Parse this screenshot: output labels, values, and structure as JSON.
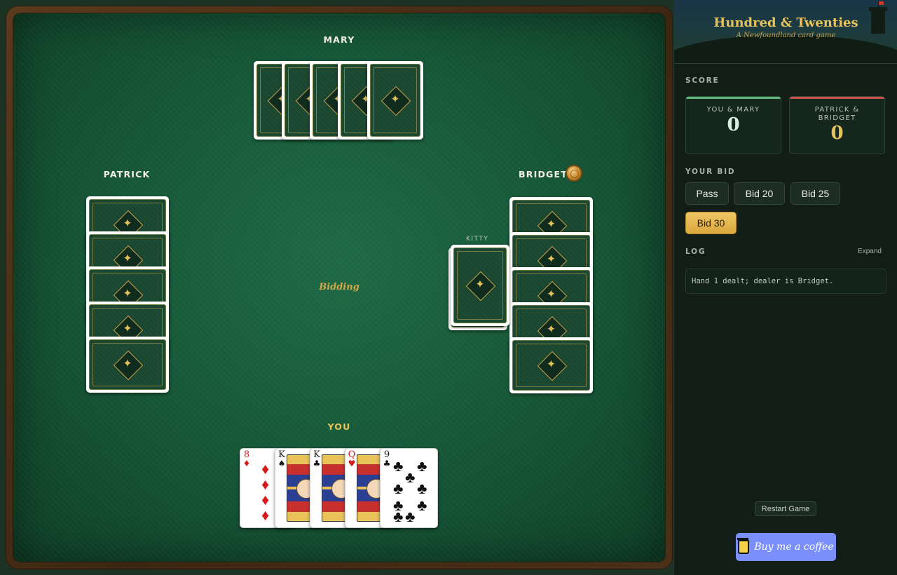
{
  "players": {
    "top": "MARY",
    "left": "PATRICK",
    "right": "BRIDGET",
    "bottom": "YOU"
  },
  "table": {
    "status": "Bidding",
    "kitty_label": "KITTY",
    "dealer": "Bridget"
  },
  "hand": [
    {
      "rank": "8",
      "suit": "♦",
      "color": "red"
    },
    {
      "rank": "K",
      "suit": "♠",
      "color": "black"
    },
    {
      "rank": "K",
      "suit": "♣",
      "color": "black"
    },
    {
      "rank": "Q",
      "suit": "♥",
      "color": "red"
    },
    {
      "rank": "9",
      "suit": "♣",
      "color": "black"
    }
  ],
  "header": {
    "title": "Hundred & Twenties",
    "subtitle": "A Newfoundland card game"
  },
  "score": {
    "label": "SCORE",
    "team1": {
      "name": "YOU & MARY",
      "value": "0",
      "color": "#5db87a"
    },
    "team2": {
      "name": "PATRICK & BRIDGET",
      "value": "0",
      "color": "#c9524a"
    }
  },
  "bid": {
    "label": "YOUR BID",
    "pass": "Pass",
    "bid20": "Bid 20",
    "bid25": "Bid 25",
    "bid30": "Bid 30"
  },
  "log": {
    "label": "LOG",
    "expand": "Expand",
    "entry": "Hand 1 dealt; dealer is Bridget."
  },
  "actions": {
    "restart": "Restart Game",
    "coffee": "Buy me a coffee"
  },
  "colors": {
    "felt": "#175a39",
    "gold": "#e8c35a",
    "coffee": "#7b8ffb"
  }
}
